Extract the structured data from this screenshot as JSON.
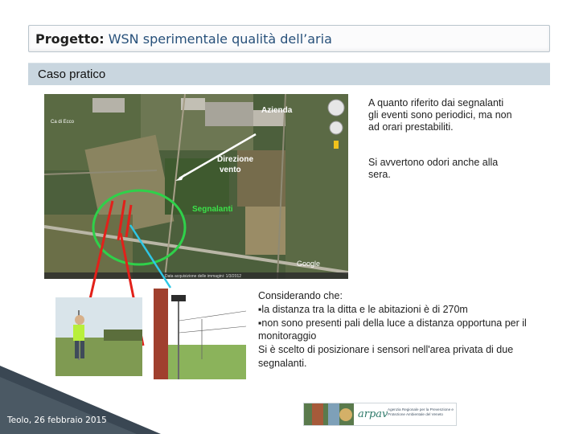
{
  "header": {
    "title_prefix": "Progetto:",
    "title_rest": " WSN sperimentale qualità dell’aria"
  },
  "section": {
    "title": "Caso pratico"
  },
  "map": {
    "labels": {
      "place": "Ca di Ecco",
      "azienda": "Azienda",
      "direzione_1": "Direzione",
      "direzione_2": "vento",
      "segnalanti": "Segnalanti",
      "provider": "Google",
      "imagery": "Data acquisizione delle immagini: 1/3/2012"
    }
  },
  "text": {
    "p1": "A quanto riferito dai segnalanti gli eventi sono periodici, ma non ad orari prestabiliti.",
    "p2": "Si avvertono odori anche alla sera."
  },
  "considerations": {
    "intro": "Considerando che:",
    "bullets": [
      "▪la distanza tra la ditta e le abitazioni è di 270m",
      "▪non sono presenti pali della luce a distanza opportuna per il monitoraggio"
    ],
    "conclusion": "Si è scelto di posizionare i sensori nell'area privata di due segnalanti."
  },
  "footer": {
    "date": "Teolo, 26 febbraio 2015"
  },
  "logo": {
    "name": "arpav",
    "caption": "Agenzia Regionale per la Prevenzione e Protezione Ambientale del Veneto"
  },
  "colors": {
    "title_accent": "#27507a",
    "section_bar": "#c9d6df",
    "circle_green": "#2fd14a",
    "arrow_red": "#e2211a",
    "arrow_cyan": "#2ec7e6",
    "segnalanti_text": "#3be24a",
    "footer_slate": "#3a4753"
  }
}
